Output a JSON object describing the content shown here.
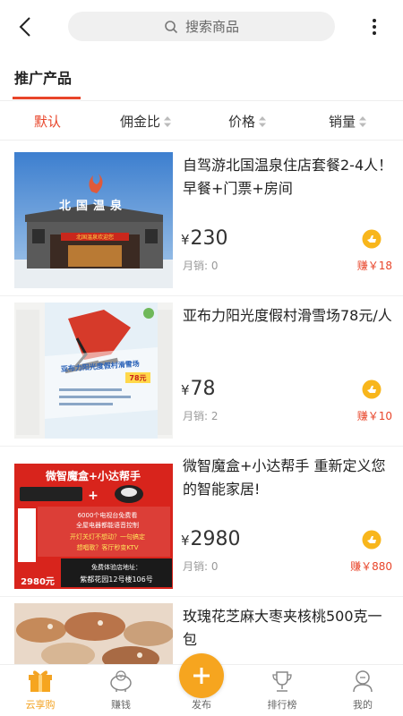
{
  "header": {
    "search_placeholder": "搜索商品"
  },
  "section": {
    "title": "推广产品"
  },
  "sort": {
    "items": [
      {
        "label": "默认",
        "active": true
      },
      {
        "label": "佣金比",
        "active": false
      },
      {
        "label": "价格",
        "active": false
      },
      {
        "label": "销量",
        "active": false
      }
    ]
  },
  "products": [
    {
      "name": "自驾游北国温泉住店套餐2-4人！早餐+门票+房间",
      "currency": "¥",
      "price": "230",
      "sales": "月销: 0",
      "earn": "赚￥18",
      "image_text": {
        "sign": "北国温泉",
        "banner": "北国温泉欢迎您"
      }
    },
    {
      "name": "亚布力阳光度假村滑雪场78元/人",
      "currency": "¥",
      "price": "78",
      "sales": "月销: 2",
      "earn": "赚￥10",
      "image_text": {
        "headline": "亚布力阳光度假村滑雪场",
        "price_tag": "78元"
      }
    },
    {
      "name": "微智魔盒+小达帮手 重新定义您的智能家居!",
      "currency": "¥",
      "price": "2980",
      "sales": "月销: 0",
      "earn": "赚￥880",
      "image_text": {
        "title": "微智魔盒+小达帮手",
        "line1": "6000个电视台免费看",
        "line2": "全屋电器都能语音控制",
        "line3": "开灯关灯不想动？一句搞定",
        "line4": "想唱歌？客厅秒变KTV",
        "addr_title": "免费体验店地址：",
        "addr": "紫都花园12号楼106号",
        "price": "2980元"
      }
    },
    {
      "name": "玫瑰花芝麻大枣夹核桃500克一包",
      "currency": "¥",
      "price": "",
      "sales": "",
      "earn": ""
    }
  ],
  "nav": {
    "items": [
      {
        "label": "云享购",
        "icon": "gift-icon",
        "active": true
      },
      {
        "label": "赚钱",
        "icon": "piggy-bank-icon",
        "active": false
      },
      {
        "label": "发布",
        "icon": "plus-icon",
        "active": false
      },
      {
        "label": "排行榜",
        "icon": "trophy-icon",
        "active": false
      },
      {
        "label": "我的",
        "icon": "user-icon",
        "active": false
      }
    ]
  },
  "colors": {
    "accent": "#e8452a",
    "nav_active": "#f3a323",
    "publish": "#f6a51f"
  }
}
